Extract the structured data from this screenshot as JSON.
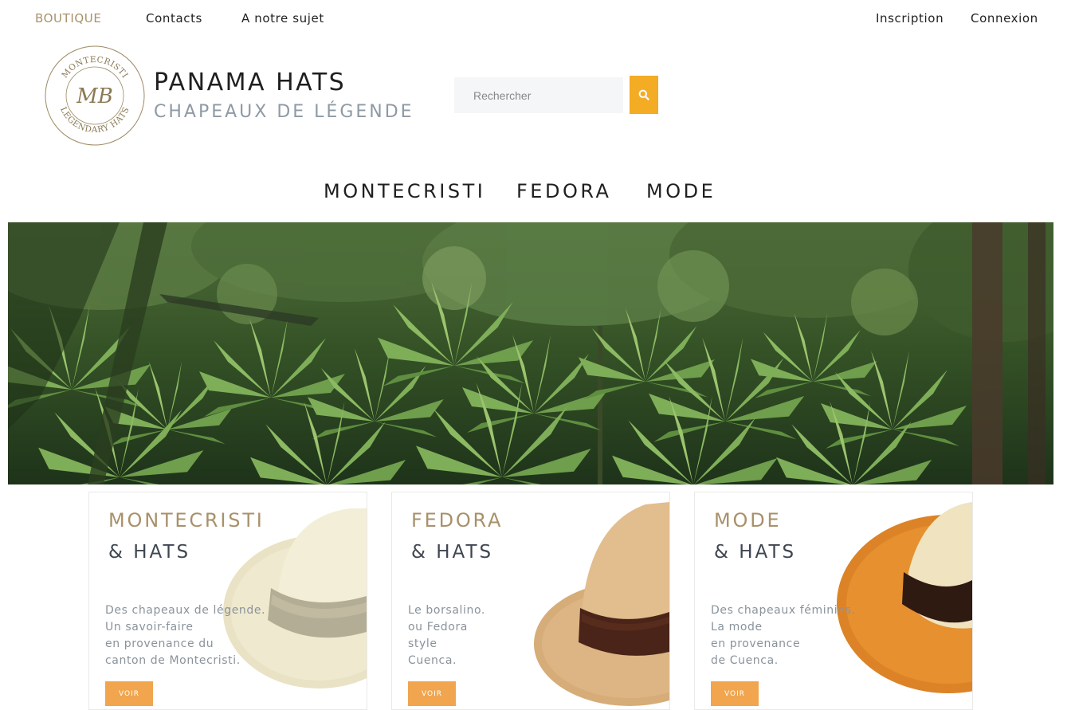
{
  "topbar": {
    "left": [
      "BOUTIQUE",
      "Contacts",
      "A notre sujet"
    ],
    "right": [
      "Inscription",
      "Connexion"
    ]
  },
  "logo": {
    "top_text": "MONTECRISTI",
    "bottom_text": "LEGENDARY HATS",
    "monogram": "MB"
  },
  "brand": {
    "title": "PANAMA HATS",
    "subtitle": "CHAPEAUX DE LÉGENDE"
  },
  "search": {
    "placeholder": "Rechercher",
    "icon": "search-icon"
  },
  "mainnav": [
    "MONTECRISTI",
    "FEDORA",
    "MODE"
  ],
  "hero": {
    "image": "tropical palm forest"
  },
  "cards": [
    {
      "title": "MONTECRISTI",
      "subtitle": "& HATS",
      "lines": [
        "Des chapeaux de légende.",
        "Un savoir-faire",
        "en provenance du",
        "canton de Montecristi."
      ],
      "button": "VOIR",
      "hat_color": "#ece5c8"
    },
    {
      "title": "FEDORA",
      "subtitle": "& HATS",
      "lines": [
        "Le borsalino.",
        "ou Fedora",
        "style",
        "Cuenca."
      ],
      "button": "VOIR",
      "hat_color": "#dcb584"
    },
    {
      "title": "MODE",
      "subtitle": "& HATS",
      "lines": [
        "Des chapeaux féminins.",
        "La mode",
        "en provenance",
        "de Cuenca."
      ],
      "button": "VOIR",
      "hat_color": "#e0862a"
    }
  ],
  "colors": {
    "accent": "#f4ac24",
    "gold": "#a8916a",
    "button": "#f0a54e"
  }
}
